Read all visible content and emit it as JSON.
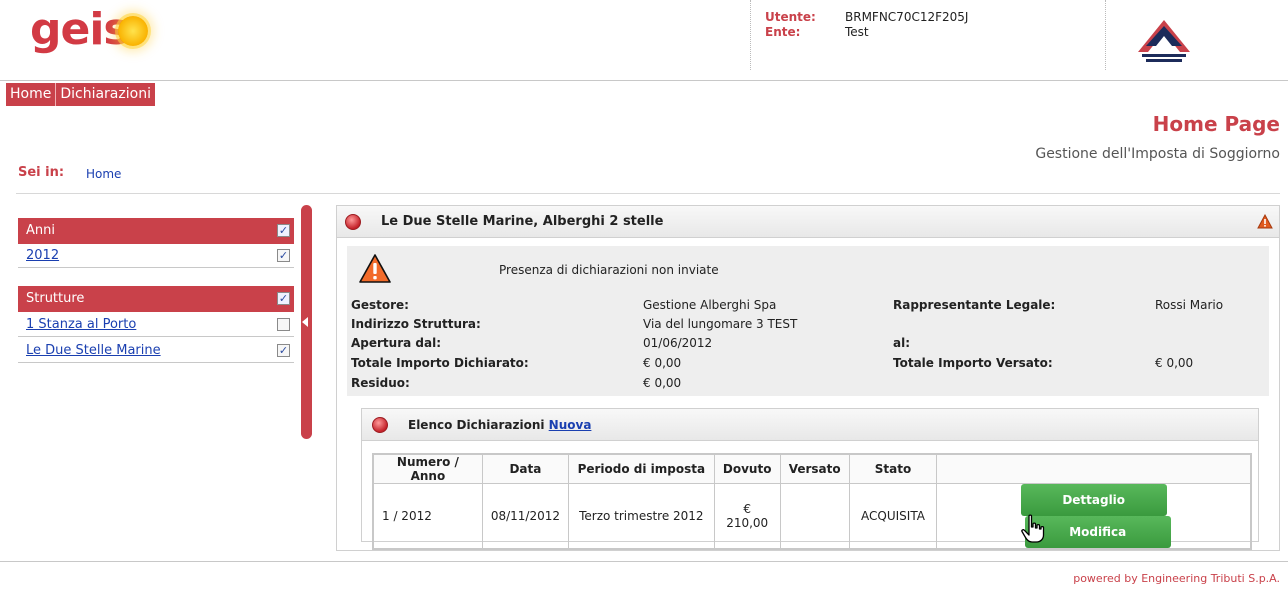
{
  "header": {
    "logo_text": "geis",
    "user_label": "Utente:",
    "user_value": "BRMFNC70C12F205J",
    "ente_label": "Ente:",
    "ente_value": "Test"
  },
  "nav": {
    "home": "Home",
    "dichiarazioni": "Dichiarazioni"
  },
  "page": {
    "title": "Home Page",
    "subtitle": "Gestione dell'Imposta di Soggiorno",
    "breadcrumb_label": "Sei in:",
    "breadcrumb_link": "Home"
  },
  "filters": {
    "anni": {
      "title": "Anni",
      "checked": true,
      "items": [
        {
          "label": "2012",
          "checked": true
        }
      ]
    },
    "strutture": {
      "title": "Strutture",
      "checked": true,
      "items": [
        {
          "label": "1 Stanza al Porto",
          "checked": false
        },
        {
          "label": "Le Due Stelle Marine",
          "checked": true
        }
      ]
    }
  },
  "structure": {
    "title": "Le Due Stelle Marine, Alberghi 2 stelle",
    "warning": "Presenza di dichiarazioni non inviate",
    "gestore_label": "Gestore:",
    "gestore_value": "Gestione Alberghi Spa",
    "rappresentante_label": "Rappresentante Legale:",
    "rappresentante_value": "Rossi Mario",
    "indirizzo_label": "Indirizzo Struttura:",
    "indirizzo_value": "Via del lungomare 3 TEST",
    "apertura_label": "Apertura dal:",
    "apertura_value": "01/06/2012",
    "al_label": "al:",
    "al_value": "",
    "dichiarato_label": "Totale Importo Dichiarato:",
    "dichiarato_value": "€ 0,00",
    "versato_label": "Totale Importo Versato:",
    "versato_value": "€ 0,00",
    "residuo_label": "Residuo:",
    "residuo_value": "€ 0,00"
  },
  "declarations": {
    "title": "Elenco Dichiarazioni",
    "new_link": "Nuova",
    "columns": [
      "Numero / Anno",
      "Data",
      "Periodo di imposta",
      "Dovuto",
      "Versato",
      "Stato"
    ],
    "rows": [
      {
        "numero": "1 / 2012",
        "data": "08/11/2012",
        "periodo": "Terzo trimestre 2012",
        "dovuto": "€ 210,00",
        "versato": "",
        "stato": "ACQUISITA"
      }
    ],
    "detail_button": "Dettaglio",
    "edit_button": "Modifica"
  },
  "footer": {
    "text": "powered by Engineering Tributi S.p.A."
  },
  "colors": {
    "brand_red": "#c9414a",
    "button_green": "#4aaa4d",
    "link_blue": "#1a3fb0"
  }
}
